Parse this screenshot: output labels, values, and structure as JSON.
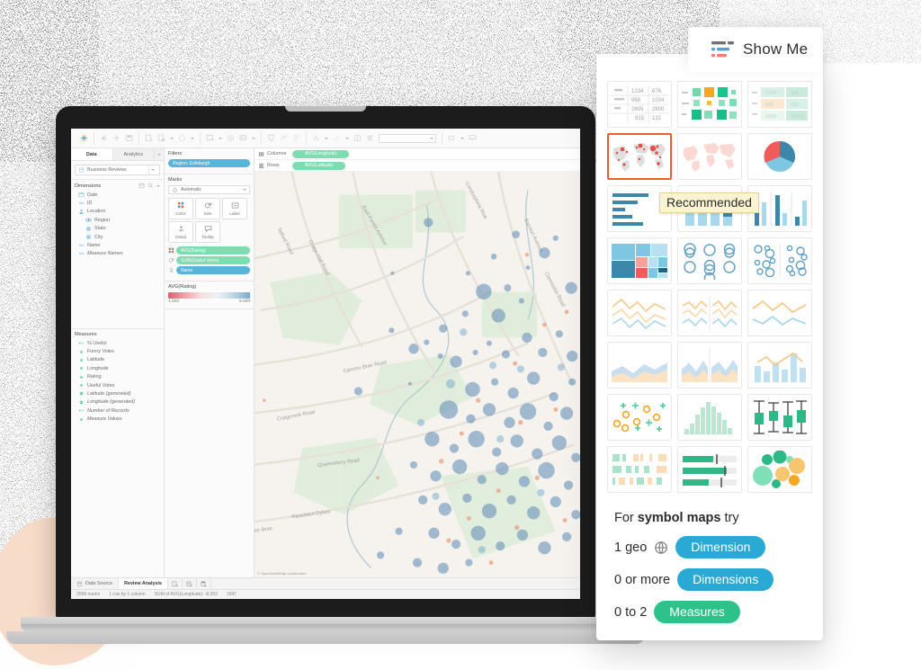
{
  "app": {
    "name": "Tableau Desktop",
    "toolbar": {
      "logo_icon": "tableau-logo-icon",
      "items": [
        {
          "name": "back-icon",
          "glyph": "arrow-left"
        },
        {
          "name": "forward-icon",
          "glyph": "arrow-right"
        },
        {
          "name": "save-icon",
          "glyph": "save"
        },
        {
          "name": "new-worksheet-icon",
          "glyph": "new-sheet"
        },
        {
          "name": "duplicate-sheet-icon",
          "glyph": "duplicate-sheet"
        },
        {
          "name": "clear-sheet-icon",
          "glyph": "clear"
        },
        {
          "name": "refresh-datasource-icon",
          "glyph": "refresh"
        },
        {
          "name": "pause-updates-icon",
          "glyph": "pause"
        },
        {
          "name": "swap-rows-columns-icon",
          "glyph": "swap"
        },
        {
          "name": "sort-ascending-icon",
          "glyph": "sort-asc"
        },
        {
          "name": "sort-descending-icon",
          "glyph": "sort-desc"
        },
        {
          "name": "highlight-icon",
          "glyph": "highlight"
        },
        {
          "name": "group-members-icon",
          "glyph": "group"
        },
        {
          "name": "show-labels-icon",
          "glyph": "labels"
        },
        {
          "name": "fit-selector",
          "glyph": "fit"
        },
        {
          "name": "fix-axes-icon",
          "glyph": "axes"
        },
        {
          "name": "show-me-icon",
          "glyph": "show-me"
        }
      ],
      "fit_value": ""
    }
  },
  "data_pane": {
    "tabs": [
      {
        "label": "Data",
        "active": true
      },
      {
        "label": "Analytics",
        "active": false
      }
    ],
    "datasource": {
      "name": "Business Reviews",
      "icon": "datasource-icon",
      "caret_icon": "chevron-down-icon"
    },
    "dimensions": {
      "title": "Dimensions",
      "tools": [
        "grid-view-icon",
        "search-icon",
        "chevron-down-icon"
      ],
      "fields": [
        {
          "label": "Date",
          "icon": "calendar-icon",
          "indent": 0
        },
        {
          "label": "ID",
          "icon": "abc-icon",
          "indent": 0
        },
        {
          "label": "Location",
          "icon": "hierarchy-icon",
          "indent": 0,
          "expanded": true
        },
        {
          "label": "Region",
          "icon": "geo-icon",
          "indent": 1
        },
        {
          "label": "State",
          "icon": "globe-icon",
          "indent": 1
        },
        {
          "label": "City",
          "icon": "globe-icon",
          "indent": 1
        },
        {
          "label": "Name",
          "icon": "abc-icon",
          "indent": 0
        },
        {
          "label": "Measure Names",
          "icon": "abc-icon",
          "indent": 0,
          "italic": true
        }
      ]
    },
    "measures": {
      "title": "Measures",
      "fields": [
        {
          "label": "% Useful",
          "icon": "number-icon"
        },
        {
          "label": "Funny Votes",
          "icon": "number-icon"
        },
        {
          "label": "Latitude",
          "icon": "number-icon"
        },
        {
          "label": "Longitude",
          "icon": "number-icon"
        },
        {
          "label": "Rating",
          "icon": "number-icon"
        },
        {
          "label": "Useful Votes",
          "icon": "number-icon"
        },
        {
          "label": "Latitude (generated)",
          "icon": "geo-number-icon",
          "italic": true
        },
        {
          "label": "Longitude (generated)",
          "icon": "geo-number-icon",
          "italic": true
        },
        {
          "label": "Number of Records",
          "icon": "number-icon",
          "italic": true
        },
        {
          "label": "Measure Values",
          "icon": "number-icon",
          "italic": true
        }
      ]
    }
  },
  "shelf_pane": {
    "filters": {
      "title": "Filters",
      "pills": [
        {
          "label": "Region: Edinburgh",
          "color": "blue"
        }
      ]
    },
    "marks": {
      "title": "Marks",
      "mark_type": "Automatic",
      "mark_type_icon": "automatic-mark-icon",
      "buttons": [
        {
          "label": "Color",
          "icon": "color-icon"
        },
        {
          "label": "Size",
          "icon": "size-icon"
        },
        {
          "label": "Label",
          "icon": "label-icon"
        },
        {
          "label": "Detail",
          "icon": "detail-icon"
        },
        {
          "label": "Tooltip",
          "icon": "tooltip-icon"
        }
      ],
      "pills": [
        {
          "label": "AVG(Rating)",
          "color": "green",
          "prop_icon": "color-icon"
        },
        {
          "label": "SUM(Useful Votes)",
          "color": "green",
          "prop_icon": "size-icon"
        },
        {
          "label": "Name",
          "color": "blue",
          "prop_icon": "detail-icon"
        }
      ]
    },
    "legend": {
      "title": "AVG(Rating)",
      "min": "1.000",
      "max": "5.000",
      "color_low": "#e05c6e",
      "color_high": "#7ba9cc"
    }
  },
  "viz": {
    "columns": {
      "label": "Columns",
      "icon": "columns-icon",
      "pills": [
        {
          "label": "AVG(Longitude)",
          "color": "green"
        }
      ]
    },
    "rows": {
      "label": "Rows",
      "icon": "rows-icon",
      "pills": [
        {
          "label": "AVG(Latitude)",
          "color": "green"
        }
      ]
    },
    "map_attribution": "© OpenStreetMap contributors",
    "map_labels": [
      "Telford Road",
      "Craigs Hall Road",
      "East Forest Avenue",
      "Corstorphine Rise",
      "Cammo Brae Road",
      "Craigcrook Road",
      "Queensferry Road",
      "Ravelston Dykes",
      "Drum Brae",
      "Barnton Avenue",
      "Clermiston Road"
    ]
  },
  "status_bar": {
    "datasource_tab": "Data Source",
    "sheet_tab": "Review Analysis",
    "sheet_icons": [
      "new-worksheet-icon",
      "new-dashboard-icon",
      "new-story-icon"
    ],
    "marks_count": "2598 marks",
    "rows_cols": "1 row by 1 column",
    "aggregate": "SUM of AVG(Longitude): -8.302",
    "extra": "1847"
  },
  "show_me": {
    "title": "Show Me",
    "title_icon": "show-me-icon",
    "selected_chart": "symbol-maps",
    "tooltip": "Recommended",
    "charts": [
      {
        "name": "text-table",
        "label": "text tables"
      },
      {
        "name": "heat-map",
        "label": "heat maps"
      },
      {
        "name": "highlight-table",
        "label": "highlight tables"
      },
      {
        "name": "symbol-map",
        "label": "symbol maps",
        "selected": true
      },
      {
        "name": "filled-map",
        "label": "maps"
      },
      {
        "name": "pie-chart",
        "label": "pie charts"
      },
      {
        "name": "horizontal-bars",
        "label": "horizontal bars"
      },
      {
        "name": "stacked-bars",
        "label": "stacked bars"
      },
      {
        "name": "side-by-side-bars",
        "label": "side-by-side bars"
      },
      {
        "name": "treemap",
        "label": "treemaps"
      },
      {
        "name": "circle-views",
        "label": "circle views"
      },
      {
        "name": "side-by-side-circles",
        "label": "side-by-side circle views"
      },
      {
        "name": "lines-continuous",
        "label": "lines (continuous)"
      },
      {
        "name": "lines-discrete",
        "label": "lines (discrete)"
      },
      {
        "name": "dual-lines",
        "label": "dual lines"
      },
      {
        "name": "area-continuous",
        "label": "area charts (continuous)"
      },
      {
        "name": "area-discrete",
        "label": "area charts (discrete)"
      },
      {
        "name": "dual-combination",
        "label": "dual combination"
      },
      {
        "name": "scatter-plot",
        "label": "scatter plots"
      },
      {
        "name": "histogram",
        "label": "histograms"
      },
      {
        "name": "box-and-whisker",
        "label": "box-and-whisker plots"
      },
      {
        "name": "gantt",
        "label": "gantt charts"
      },
      {
        "name": "bullet-graph",
        "label": "bullet graphs"
      },
      {
        "name": "packed-bubbles",
        "label": "packed bubbles"
      }
    ],
    "footer": {
      "prefix": "For",
      "chart_name": "symbol maps",
      "suffix": "try",
      "requirements": [
        {
          "qty": "1 geo",
          "icon": "globe-icon",
          "chip": "Dimension",
          "chip_color": "blue"
        },
        {
          "qty": "0 or more",
          "icon": null,
          "chip": "Dimensions",
          "chip_color": "blue"
        },
        {
          "qty": "0 to 2",
          "icon": null,
          "chip": "Measures",
          "chip_color": "green"
        }
      ]
    }
  },
  "colors": {
    "accent_orange": "#e8612c",
    "tableau_blue": "#2aa9d4",
    "tableau_green": "#2ec28b",
    "pill_green": "#7ddcb0",
    "pill_blue": "#59b4d9"
  }
}
